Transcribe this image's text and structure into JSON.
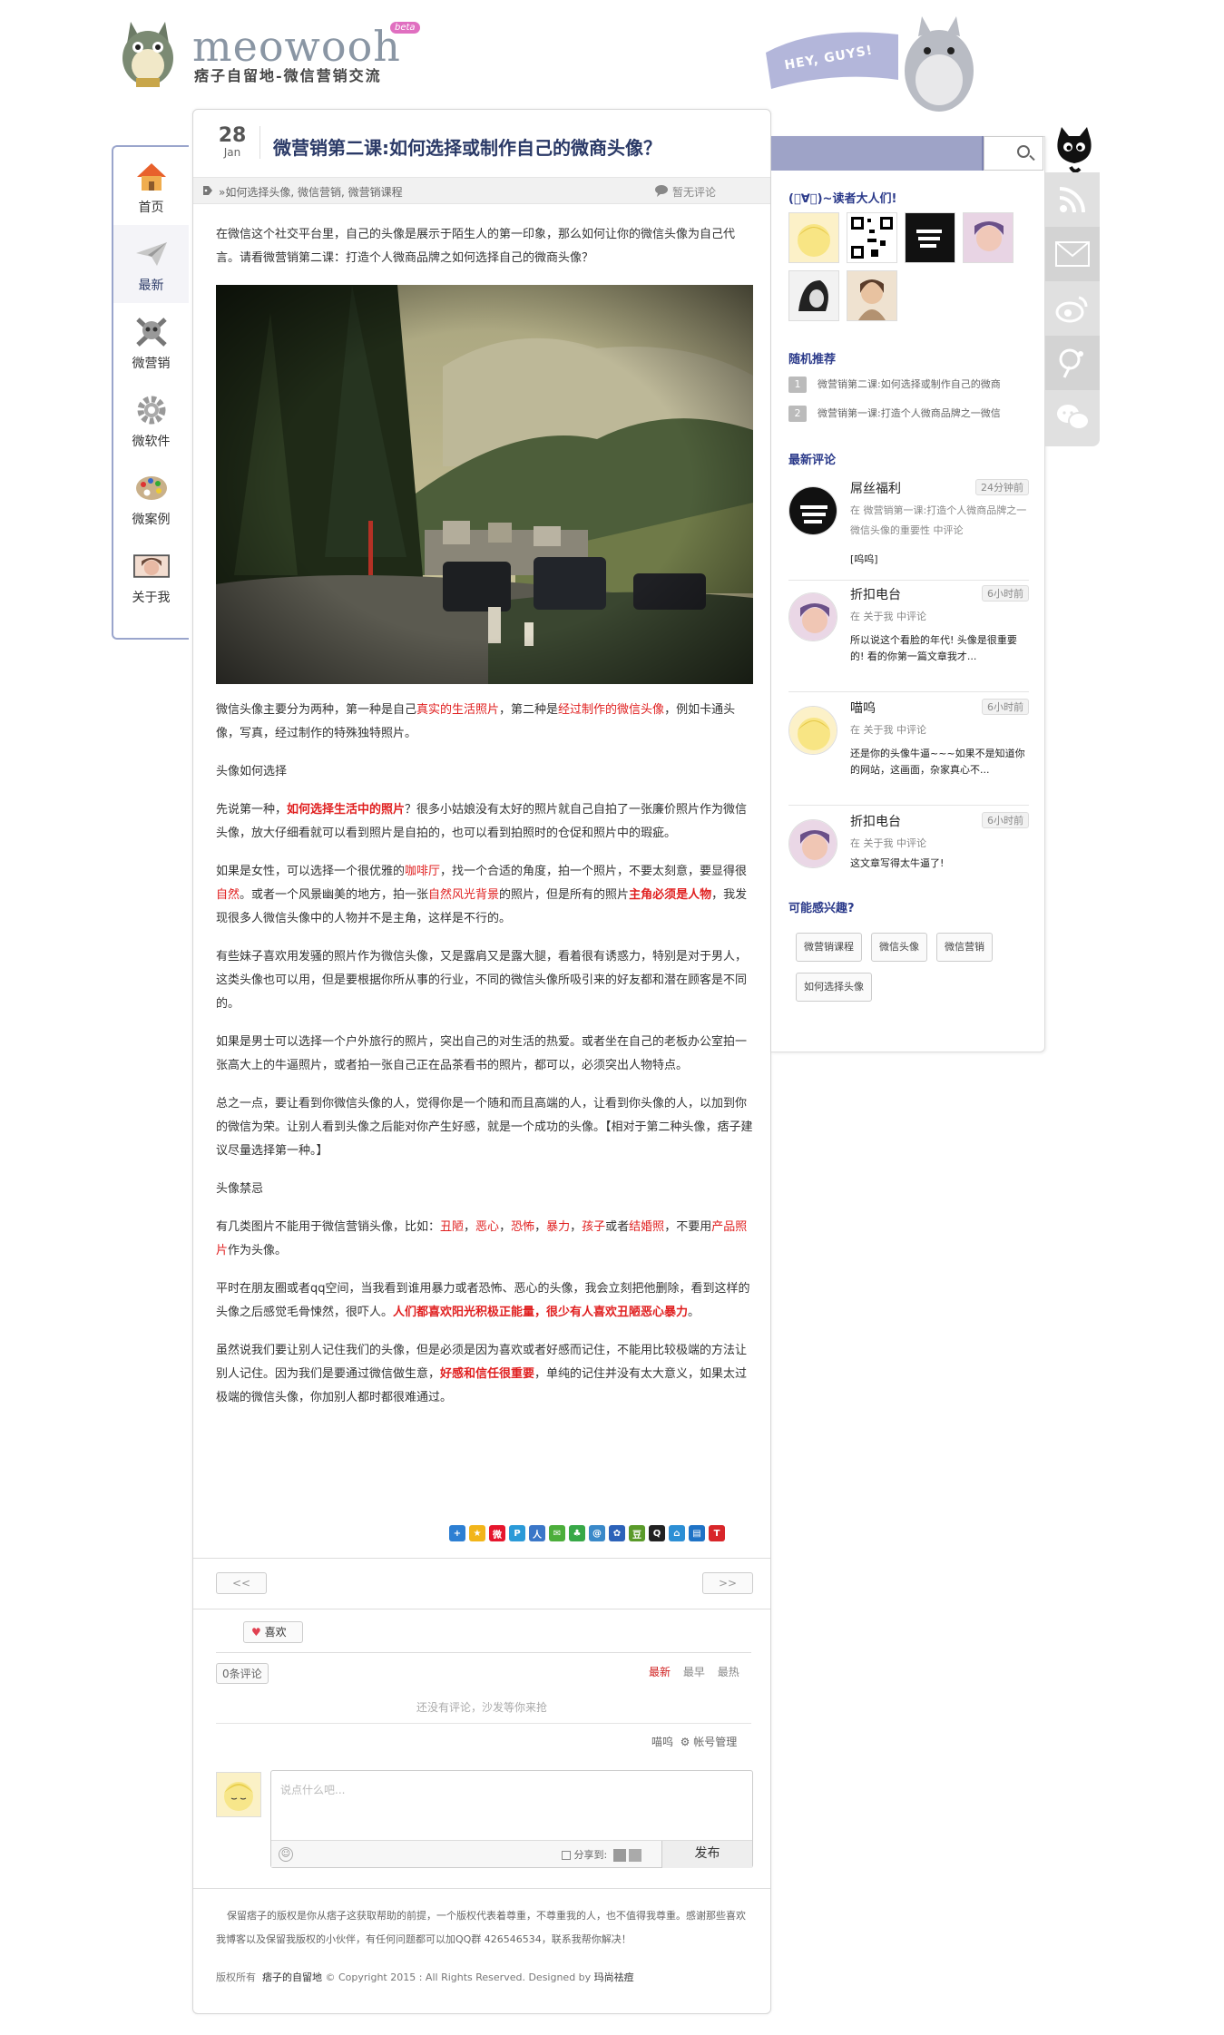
{
  "header": {
    "brand": "meowooh",
    "beta": "beta",
    "tagline": "痞子自留地-微信营销交流",
    "hey": "HEY, GUYS!"
  },
  "nav": [
    {
      "label": "首页",
      "icon": "home-icon"
    },
    {
      "label": "最新",
      "icon": "paper-plane-icon"
    },
    {
      "label": "微营销",
      "icon": "skull-icon"
    },
    {
      "label": "微软件",
      "icon": "gear-icon"
    },
    {
      "label": "微案例",
      "icon": "palette-icon"
    },
    {
      "label": "关于我",
      "icon": "portrait-icon"
    }
  ],
  "post": {
    "day": "28",
    "month": "Jan",
    "title": "微营销第二课:如何选择或制作自己的微商头像？",
    "tags": "»如何选择头像, 微信营销, 微营销课程",
    "comments": "暂无评论",
    "paragraphs": {
      "p1": "在微信这个社交平台里，自己的头像是展示于陌生人的第一印象，那么如何让你的微信头像为自己代言。请看微营销第二课：打造个人微商品牌之如何选择自己的微商头像？",
      "p2a": "微信头像主要分为两种，第一种是自己",
      "p2b": "真实的生活照片",
      "p2c": "，第二种是",
      "p2d": "经过制作的微信头像",
      "p2e": "，例如卡通头像，写真，经过制作的特殊独特照片。",
      "p3": "头像如何选择",
      "p4a": "先说第一种，",
      "p4b": "如何选择生活中的照片",
      "p4c": "？很多小姑娘没有太好的照片就自己自拍了一张廉价照片作为微信头像，放大仔细看就可以看到照片是自拍的，也可以看到拍照时的仓促和照片中的瑕疵。",
      "p5a": "如果是女性，可以选择一个很优雅的",
      "p5b": "咖啡厅",
      "p5c": "，找一个合适的角度，拍一个照片，不要太刻意，要显得很",
      "p5d": "自然",
      "p5e": "。或者一个风景幽美的地方，拍一张",
      "p5f": "自然风光背景",
      "p5g": "的照片，但是所有的照片",
      "p5h": "主角必须是人物",
      "p5i": "，我发现很多人微信头像中的人物并不是主角，这样是不行的。",
      "p6": "有些妹子喜欢用发骚的照片作为微信头像，又是露肩又是露大腿，看着很有诱惑力，特别是对于男人，这类头像也可以用，但是要根据你所从事的行业，不同的微信头像所吸引来的好友都和潜在顾客是不同的。",
      "p7": "如果是男士可以选择一个户外旅行的照片，突出自己的对生活的热爱。或者坐在自己的老板办公室拍一张高大上的牛逼照片，或者拍一张自己正在品茶看书的照片，都可以，必须突出人物特点。",
      "p8": "总之一点，要让看到你微信头像的人，觉得你是一个随和而且高端的人，让看到你头像的人，以加到你的微信为荣。让别人看到头像之后能对你产生好感，就是一个成功的头像。【相对于第二种头像，痞子建议尽量选择第一种。】",
      "p9": "头像禁忌",
      "p10a": "有几类图片不能用于微信营销头像，比如：",
      "p10b": "丑陋",
      "p10c": "，",
      "p10d": "恶心",
      "p10e": "，",
      "p10f": "恐怖",
      "p10g": "，",
      "p10h": "暴力",
      "p10i": "，",
      "p10j": "孩子",
      "p10k": "或者",
      "p10l": "结婚照",
      "p10m": "，不要用",
      "p10n": "产品照片",
      "p10o": "作为头像。",
      "p11a": "平时在朋友圈或者qq空间，当我看到谁用暴力或者恐怖、恶心的头像，我会立刻把他删除，看到这样的头像之后感觉毛骨悚然，很吓人。",
      "p11b": "人们都喜欢阳光积极正能量，很少有人喜欢丑陋恶心暴力",
      "p11c": "。",
      "p12a": "虽然说我们要让别人记住我们的头像，但是必须是因为喜欢或者好感而记住，不能用比较极端的方法让别人记住。因为我们是要通过微信做生意，",
      "p12b": "好感和信任很重要",
      "p12c": "，单纯的记住并没有太大意义，如果太过极端的微信头像，你加别人都时都很难通过。"
    }
  },
  "pager": {
    "prev": "<<",
    "next": ">>"
  },
  "like": {
    "heart": "♥",
    "label": "喜欢"
  },
  "comment_area": {
    "count": "0条评论",
    "sort": [
      "最新",
      "最早",
      "最热"
    ],
    "empty": "还没有评论，沙发等你来抢",
    "user": "喵呜",
    "account": "⚙ 帐号管理",
    "placeholder": "说点什么吧...",
    "share_to": "分享到:",
    "publish": "发布"
  },
  "footer": {
    "notice": "保留痞子的版权是你从痞子这获取帮助的前提，一个版权代表着尊重，不尊重我的人，也不值得我尊重。感谢那些喜欢我博客以及保留我版权的小伙伴，有任何问题都可以加QQ群 426546534，联系我帮你解决！",
    "copy_prefix": "版权所有",
    "site": "痞子的自留地",
    "copy_mid": "© Copyright 2015 : All Rights Reserved. Designed by",
    "designer": "玛尚祛痘"
  },
  "sidebar": {
    "readers_title": "(ﾟ∀ﾟ)~读者大人们!",
    "random_title": "随机推荐",
    "random": [
      {
        "n": "1",
        "text": "微营销第二课:如何选择或制作自己的微商"
      },
      {
        "n": "2",
        "text": "微营销第一课:打造个人微商品牌之一微信"
      }
    ],
    "latest_title": "最新评论",
    "latest": [
      {
        "name": "屌丝福利",
        "time": "24分钟前",
        "where": "在 微营销第一课:打造个人微商品牌之一微信头像的重要性 中评论",
        "text": "[呜呜]"
      },
      {
        "name": "折扣电台",
        "time": "6小时前",
        "where": "在 关于我 中评论",
        "text": "所以说这个看脸的年代! 头像是很重要的! 看的你第一篇文章我才..."
      },
      {
        "name": "喵呜",
        "time": "6小时前",
        "where": "在 关于我 中评论",
        "text": "还是你的头像牛逼~~~如果不是知道你的网站，这画面，杂家真心不..."
      },
      {
        "name": "折扣电台",
        "time": "6小时前",
        "where": "在 关于我 中评论",
        "text": "这文章写得太牛逼了!"
      }
    ],
    "interest_title": "可能感兴趣?",
    "tags": [
      "微营销课程",
      "微信头像",
      "微信营销",
      "如何选择头像"
    ]
  },
  "social": [
    "rss-icon",
    "mail-icon",
    "weibo-icon",
    "qq-icon",
    "wechat-icon"
  ],
  "colors": {
    "accent": "#2b3a67",
    "nav_border": "#9aa5cc",
    "search_bar": "#9ea3c7",
    "highlight": "#e02020"
  }
}
